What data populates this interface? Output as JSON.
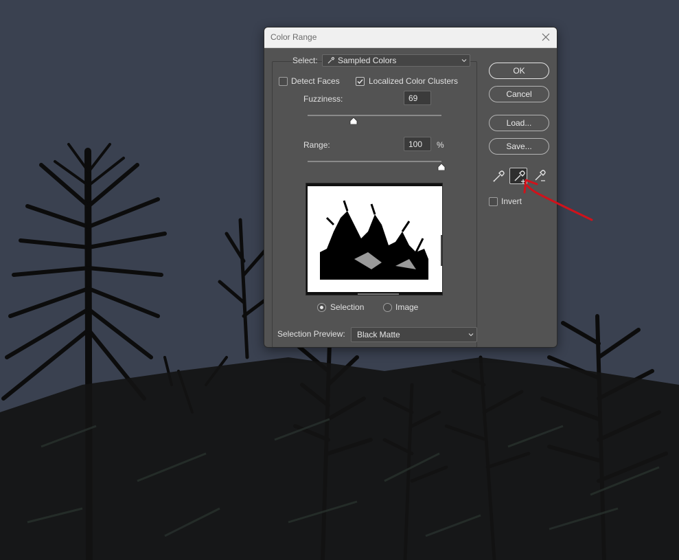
{
  "dialog": {
    "title": "Color Range",
    "select_label": "Select:",
    "select_value": "Sampled Colors",
    "detect_faces_label": "Detect Faces",
    "detect_faces_checked": false,
    "localized_label": "Localized Color Clusters",
    "localized_checked": true,
    "fuzziness_label": "Fuzziness:",
    "fuzziness_value": "69",
    "fuzziness_max": 200,
    "range_label": "Range:",
    "range_value": "100",
    "range_unit": "%",
    "view_selection_label": "Selection",
    "view_image_label": "Image",
    "view_selected": "Selection",
    "preview_mode_label": "Selection Preview:",
    "preview_mode_value": "Black Matte",
    "buttons": {
      "ok": "OK",
      "cancel": "Cancel",
      "load": "Load...",
      "save": "Save..."
    },
    "eyedroppers": [
      "eyedropper-icon",
      "eyedropper-plus-icon",
      "eyedropper-minus-icon"
    ],
    "active_eyedropper": "eyedropper-plus-icon",
    "invert_label": "Invert",
    "invert_checked": false
  },
  "colors": {
    "sky": "#3a4150",
    "dialog_bg": "#535353",
    "annotation_arrow": "#d0121b"
  }
}
